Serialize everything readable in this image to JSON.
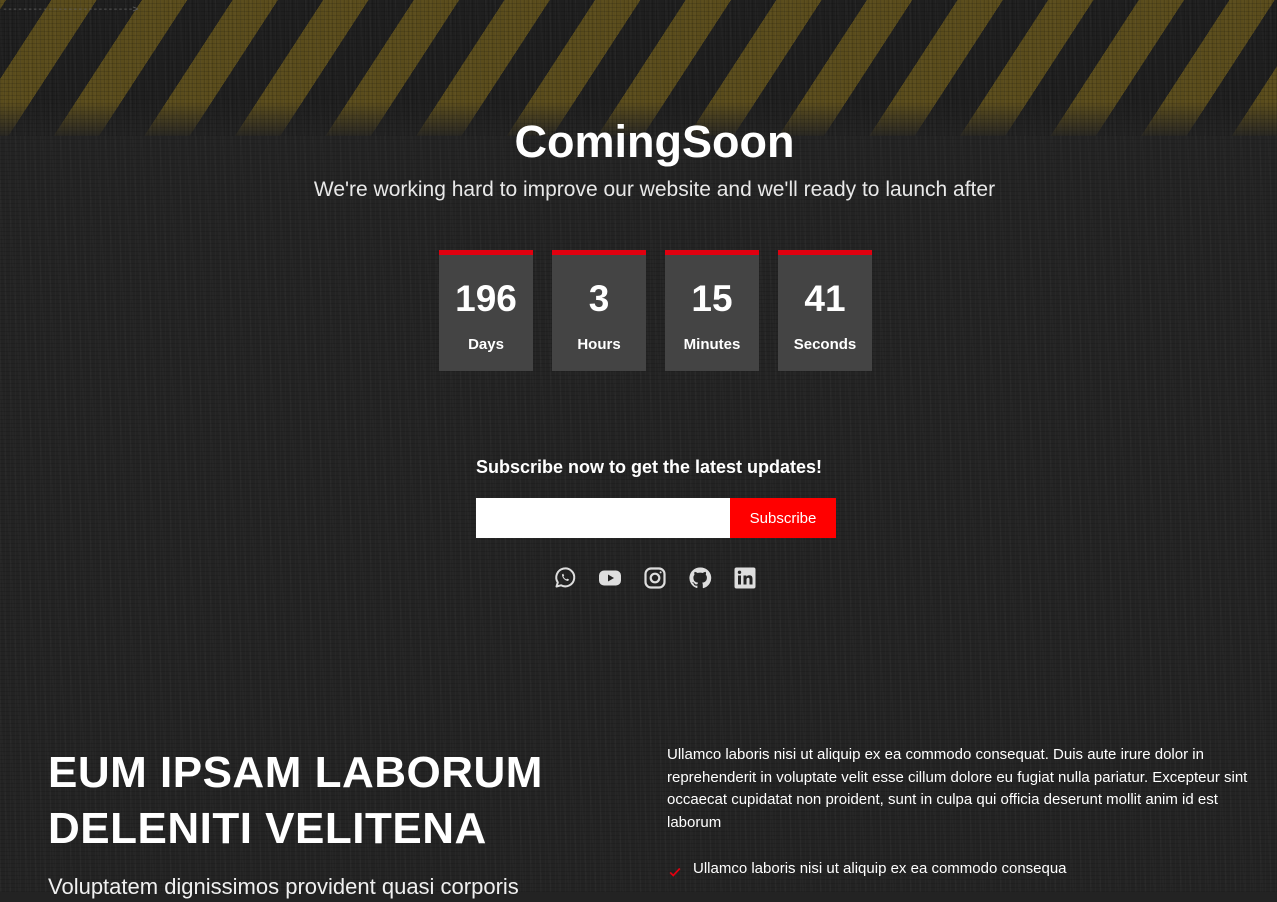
{
  "header": {
    "breadcrumb_link": "-------------------------->",
    "title": "ComingSoon",
    "subtitle": "We're working hard to improve our website and we'll ready to launch after"
  },
  "countdown": [
    {
      "value": "196",
      "label": "Days"
    },
    {
      "value": "3",
      "label": "Hours"
    },
    {
      "value": "15",
      "label": "Minutes"
    },
    {
      "value": "41",
      "label": "Seconds"
    }
  ],
  "subscribe": {
    "heading": "Subscribe now to get the latest updates!",
    "email_value": "",
    "email_placeholder": "",
    "button_label": "Subscribe"
  },
  "social_icons": [
    "whatsapp-icon",
    "youtube-icon",
    "instagram-icon",
    "github-icon",
    "linkedin-icon"
  ],
  "about": {
    "heading_line1": "EUM IPSAM LABORUM",
    "heading_line2": "DELENITI VELITENA",
    "lead": "Voluptatem dignissimos provident quasi corporis",
    "paragraph": "Ullamco laboris nisi ut aliquip ex ea commodo consequat. Duis aute irure dolor in reprehenderit in voluptate velit esse cillum dolore eu fugiat nulla pariatur. Excepteur sint occaecat cupidatat non proident, sunt in culpa qui officia deserunt mollit anim id est laborum",
    "check_items": [
      "Ullamco laboris nisi ut aliquip ex ea commodo consequa"
    ]
  },
  "colors": {
    "accent": "#ff0000",
    "countdown_border": "#e1000f",
    "background": "#232323",
    "box": "#444444",
    "hazard_stripe": "#5a4c1c"
  }
}
